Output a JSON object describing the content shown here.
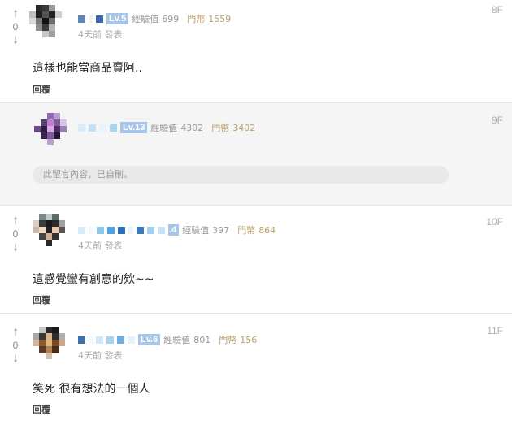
{
  "comments": [
    {
      "floor": "8F",
      "votes": "0",
      "level": "Lv.5",
      "exp_label": "經驗值",
      "exp": "699",
      "coin_label": "門幣",
      "coins": "1559",
      "time": "4天前 發表",
      "text": "這樣也能當商品賣阿..",
      "reply": "回覆"
    },
    {
      "floor": "9F",
      "level": "Lv.13",
      "exp_label": "經驗值",
      "exp": "4302",
      "coin_label": "門幣",
      "coins": "3402",
      "deleted_text": "此留言內容，已自刪。"
    },
    {
      "floor": "10F",
      "votes": "0",
      "level": ".4",
      "exp_label": "經驗值",
      "exp": "397",
      "coin_label": "門幣",
      "coins": "864",
      "time": "4天前 發表",
      "text": "這感覺蠻有創意的欸~~",
      "reply": "回覆"
    },
    {
      "floor": "11F",
      "votes": "0",
      "level": "Lv.6",
      "exp_label": "經驗值",
      "exp": "801",
      "coin_label": "門幣",
      "coins": "156",
      "time": "4天前 發表",
      "text": "笑死 很有想法的一個人",
      "reply": "回覆"
    }
  ],
  "icons": {
    "upvote": "arrow-up-icon",
    "downvote": "arrow-down-icon"
  },
  "colors": {
    "level_badge": "#a6c5e8",
    "coin_text": "#b9a06a",
    "reply_bg": "#f5f5f5",
    "deleted_pill": "#e9e9e9"
  }
}
